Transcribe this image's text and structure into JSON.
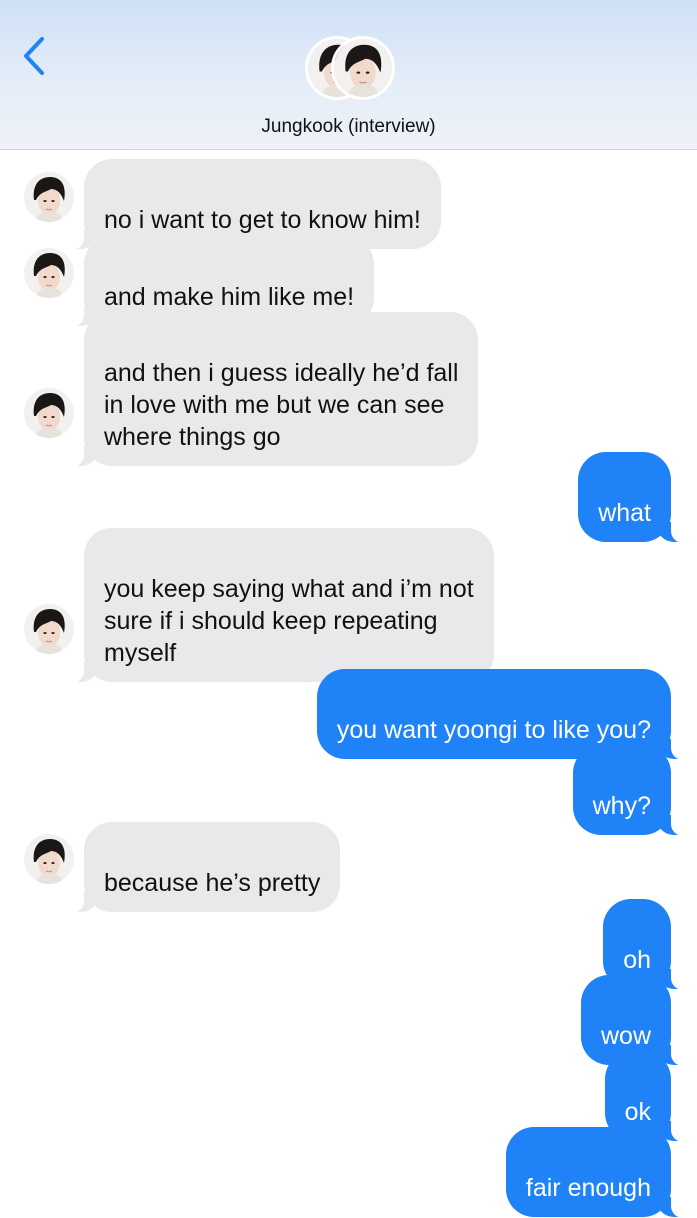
{
  "header": {
    "back_icon": "chevron-left-icon",
    "contact_name": "Jungkook (interview)",
    "accent_color": "#1f82f6"
  },
  "colors": {
    "incoming_bubble": "#e9e9eb",
    "outgoing_bubble": "#1f82f6"
  },
  "messages": [
    {
      "from": "contact",
      "text": "no i want to get to know him!"
    },
    {
      "from": "contact",
      "text": "and make him like me!"
    },
    {
      "from": "contact",
      "text": "and then i guess ideally he’d fall\nin love with me but we can see\nwhere things go"
    },
    {
      "from": "me",
      "text": "what"
    },
    {
      "from": "contact",
      "text": "you keep saying what and i’m not\nsure if i should keep repeating\nmyself"
    },
    {
      "from": "me",
      "text": "you want yoongi to like you?"
    },
    {
      "from": "me",
      "text": "why?"
    },
    {
      "from": "contact",
      "text": "because he’s pretty"
    },
    {
      "from": "me",
      "text": "oh"
    },
    {
      "from": "me",
      "text": "wow"
    },
    {
      "from": "me",
      "text": "ok"
    },
    {
      "from": "me",
      "text": "fair enough"
    }
  ]
}
